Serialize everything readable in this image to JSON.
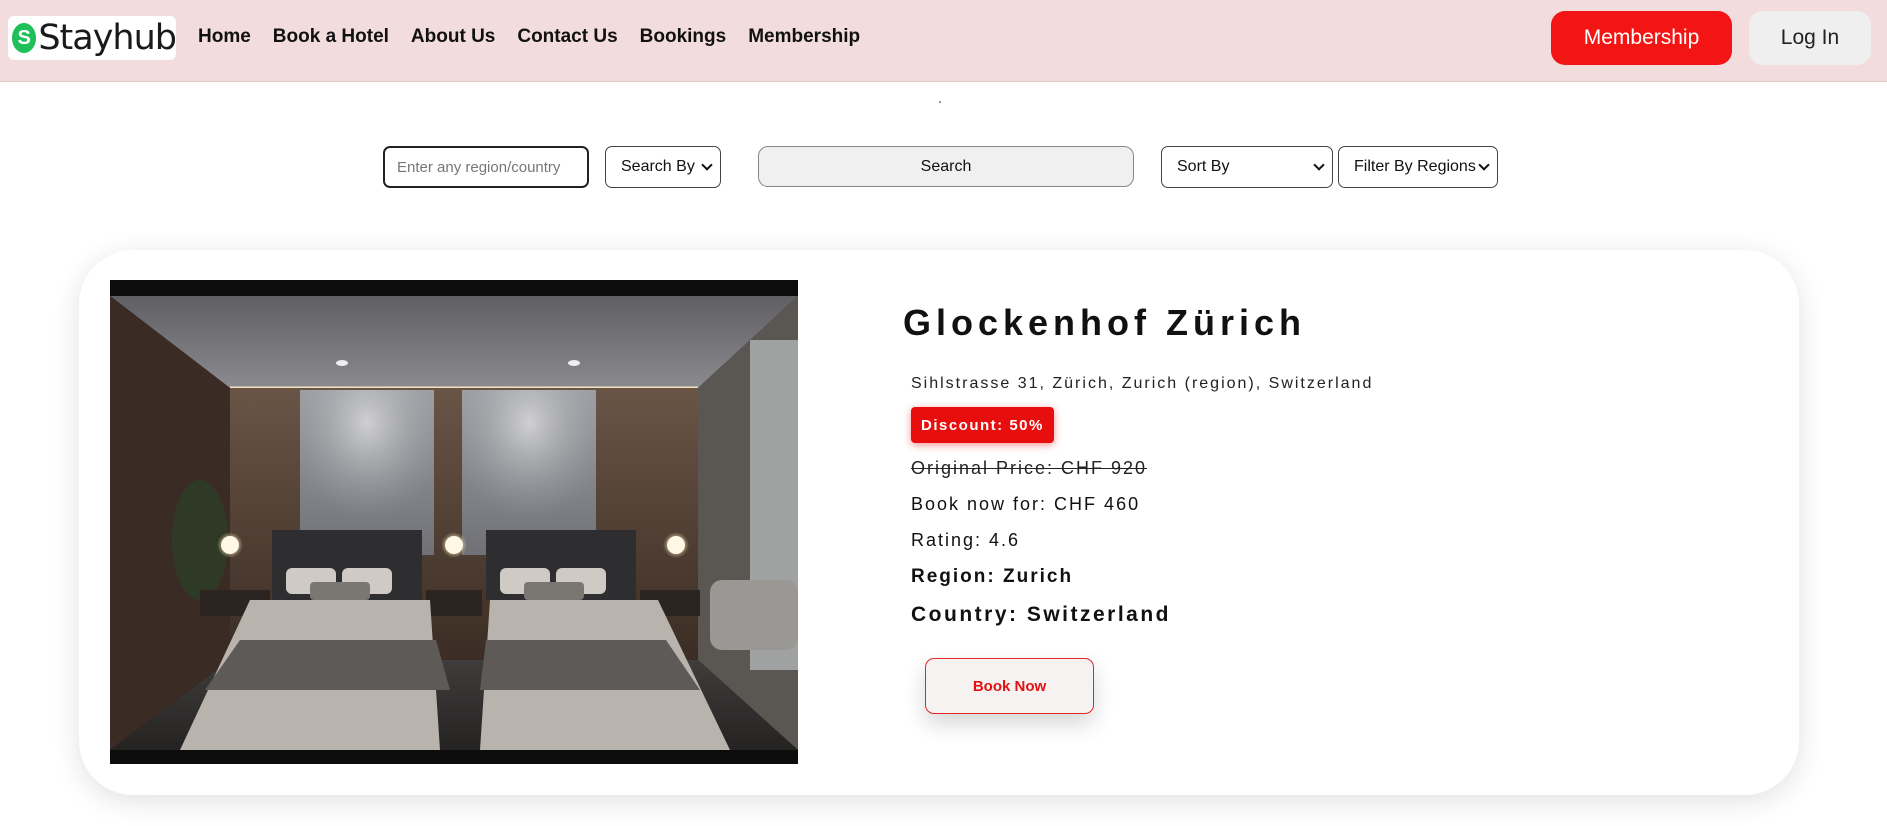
{
  "brand": {
    "logo_text": "Stayhub",
    "logo_mark": "S",
    "accent": "#f31414",
    "logo_green": "#1fbf5a"
  },
  "nav": {
    "items": [
      {
        "label": "Home"
      },
      {
        "label": "Book a Hotel"
      },
      {
        "label": "About Us"
      },
      {
        "label": "Contact Us"
      },
      {
        "label": "Bookings"
      },
      {
        "label": "Membership"
      }
    ],
    "membership_button": "Membership",
    "login_button": "Log In"
  },
  "search": {
    "placeholder": "Enter any region/country",
    "search_by": "Search By",
    "button": "Search",
    "sort_by": "Sort By",
    "filter": "Filter By Regions"
  },
  "hotel": {
    "name": "Glockenhof Zürich",
    "address": "Sihlstrasse 31, Zürich, Zurich (region), Switzerland",
    "discount": "Discount: 50%",
    "original_price": "Original Price: CHF 920",
    "book_price": "Book now for: CHF 460",
    "rating": "Rating: 4.6",
    "region": "Region: Zurich",
    "country": "Country: Switzerland",
    "book_button": "Book Now",
    "image_subject": "hotel-room-photo"
  }
}
